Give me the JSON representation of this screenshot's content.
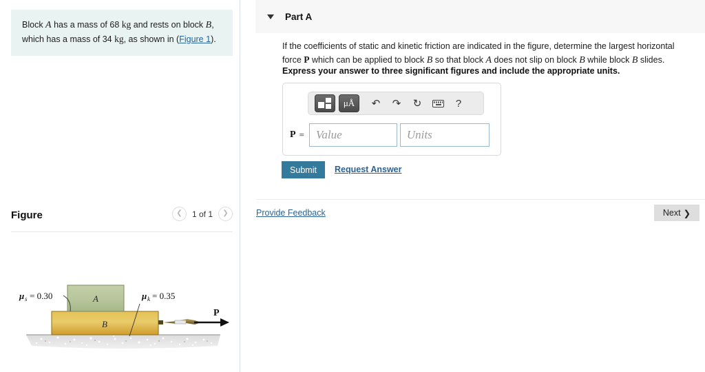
{
  "problem": {
    "line1_a": "Block ",
    "var_A": "A",
    "line1_b": " has a mass of ",
    "mass_A": "68",
    "unit_kg1": "kg",
    "line1_c": " and rests on block ",
    "var_B": "B",
    "line1_d": ",",
    "line2_a": "which has a mass of ",
    "mass_B": "34",
    "unit_kg2": "kg",
    "line2_b": ", as shown in (",
    "figure_link": "Figure 1",
    "line2_c": ")."
  },
  "figure_section": {
    "title": "Figure",
    "pager_label": "1 of 1",
    "prev_icon": "chevron-left",
    "next_icon": "chevron-right"
  },
  "figure": {
    "block_a_label": "A",
    "block_b_label": "B",
    "mu_s_label": "μ",
    "mu_s_sub": "s",
    "mu_s_eq": "= 0.30",
    "mu_k_label": "μ",
    "mu_k_sub": "k",
    "mu_k_eq": "= 0.35",
    "force_label": "P",
    "block_a_color": "#b7c69b",
    "block_b_color": "#d9a93a",
    "ground_color": "#d6d6d6"
  },
  "part": {
    "title": "Part A",
    "caret_icon": "chevron-down-icon",
    "question_pre": "If the coefficients of static and kinetic friction are indicated in the figure, determine the largest horizontal force ",
    "question_P": "P",
    "question_mid1": " which can be applied to block ",
    "question_B1": "B",
    "question_mid2": " so that block ",
    "question_A": "A",
    "question_mid3": " does not slip on block ",
    "question_B2": "B",
    "question_mid4": " while block ",
    "question_B3": "B",
    "question_end": " slides.",
    "instruction": "Express your answer to three significant figures and include the appropriate units."
  },
  "answer": {
    "variable": "P",
    "equals": "=",
    "value_placeholder": "Value",
    "value": "",
    "units_placeholder": "Units",
    "units": "",
    "toolbar": {
      "template_icon": "math-template-icon",
      "units_icon": "μÅ",
      "undo_icon": "↶",
      "redo_icon": "↷",
      "reset_icon": "↻",
      "keyboard_icon": "keyboard-icon",
      "help_icon": "?"
    }
  },
  "actions": {
    "submit_label": "Submit",
    "request_answer_label": "Request Answer",
    "feedback_label": "Provide Feedback",
    "next_label": "Next",
    "next_chevron": "❯"
  },
  "colors": {
    "accent": "#337a9c",
    "link": "#2a6496",
    "problem_bg": "#e8f3f2",
    "header_bg": "#f7f7f7"
  }
}
